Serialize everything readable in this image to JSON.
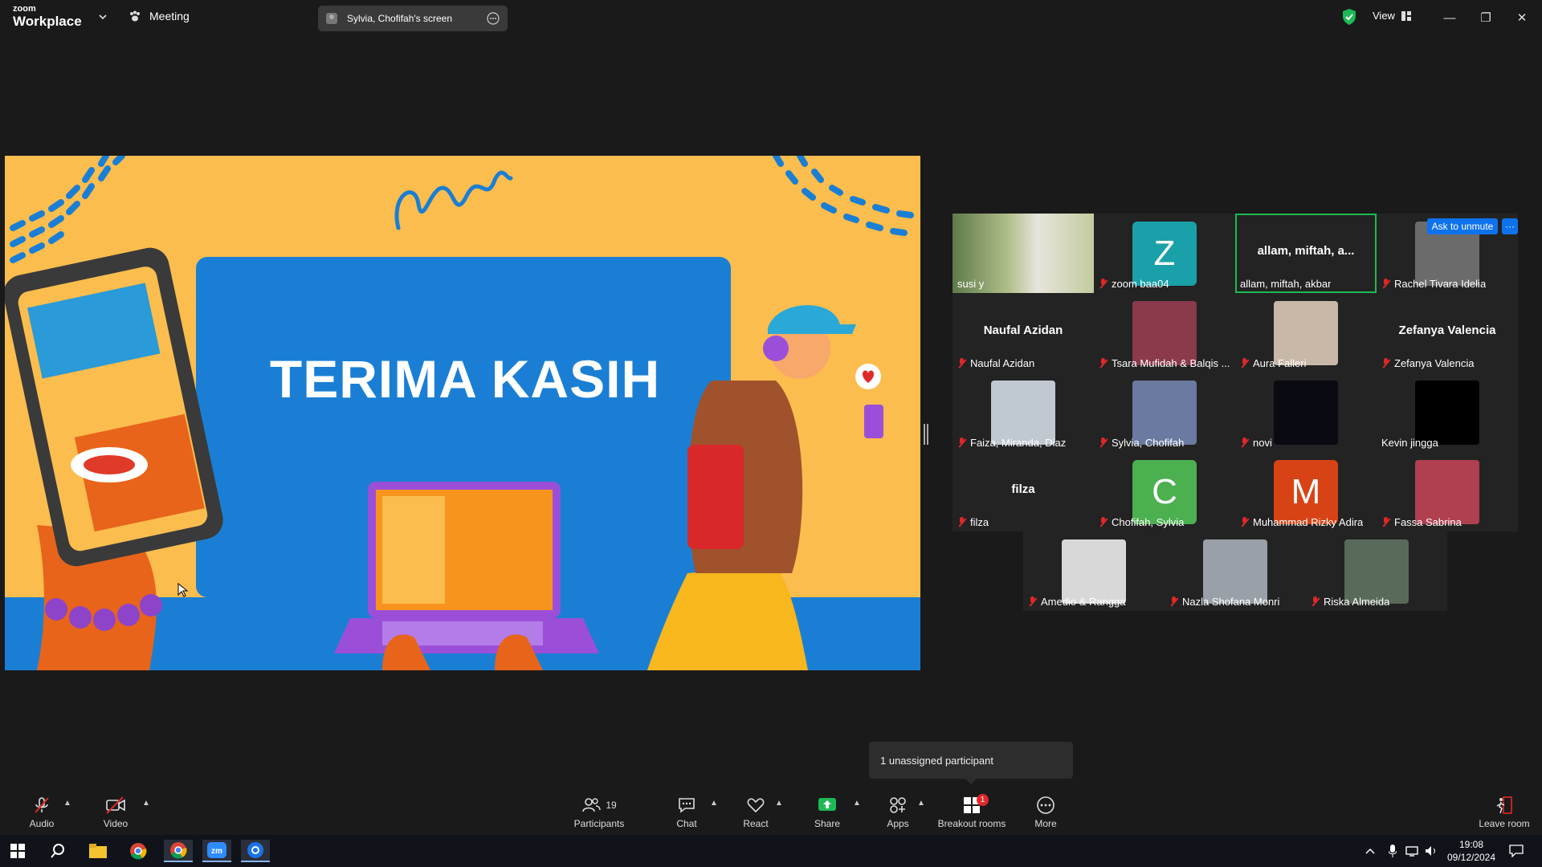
{
  "app": {
    "logo_small": "zoom",
    "logo_big": "Workplace"
  },
  "titlebar": {
    "meeting_label": "Meeting",
    "screen_label": "Sylvia, Chofifah's screen",
    "view_label": "View"
  },
  "share": {
    "title": "TERIMA KASIH"
  },
  "gallery": {
    "ask_to_unmute": "Ask to unmute",
    "more": "···",
    "tiles": [
      {
        "name": "susi y",
        "muted": false,
        "type": "photo",
        "color": "#7c9a6a"
      },
      {
        "name": "zoom baa04",
        "muted": true,
        "type": "avatar",
        "initial": "Z",
        "color": "#1aa0a8"
      },
      {
        "name": "allam, miftah, akbar",
        "muted": false,
        "type": "text",
        "center": "allam, miftah, a...",
        "highlight": true
      },
      {
        "name": "Rachel Tivara Idelia",
        "muted": true,
        "type": "photo",
        "color": "#6b6b6b"
      },
      {
        "name": "Naufal Azidan",
        "muted": true,
        "type": "text",
        "center": "Naufal Azidan"
      },
      {
        "name": "Tsara Mufidah & Balqis ...",
        "muted": true,
        "type": "photo",
        "color": "#8a3a4a"
      },
      {
        "name": "Aura Falleri",
        "muted": true,
        "type": "photo",
        "color": "#c8b8a8"
      },
      {
        "name": "Zefanya Valencia",
        "muted": true,
        "type": "text",
        "center": "Zefanya Valencia"
      },
      {
        "name": "Faiza, Miranda, Diaz",
        "muted": true,
        "type": "photo",
        "color": "#c0c8d0"
      },
      {
        "name": "Sylvia, Chofifah",
        "muted": true,
        "type": "photo",
        "color": "#6a7aa0"
      },
      {
        "name": "novi",
        "muted": true,
        "type": "photo",
        "color": "#0a0a12"
      },
      {
        "name": "Kevin jingga",
        "muted": false,
        "type": "photo",
        "color": "#000000"
      },
      {
        "name": "filza",
        "muted": true,
        "type": "text",
        "center": "filza"
      },
      {
        "name": "Chofifah, Sylvia",
        "muted": true,
        "type": "avatar",
        "initial": "C",
        "color": "#4caf50"
      },
      {
        "name": "Muhammad Rizky Adira",
        "muted": true,
        "type": "avatar",
        "initial": "M",
        "color": "#d84315"
      },
      {
        "name": "Fassa Sabrina",
        "muted": true,
        "type": "photo",
        "color": "#b04050"
      },
      {
        "name": "Amedio & Rangga",
        "muted": true,
        "type": "photo",
        "color": "#d8d8d8"
      },
      {
        "name": "Nazla Shofana Monri",
        "muted": true,
        "type": "photo",
        "color": "#9aa0a8"
      },
      {
        "name": "Riska Almeida",
        "muted": true,
        "type": "photo",
        "color": "#5a6a5a"
      }
    ]
  },
  "tooltip": {
    "text": "1 unassigned participant"
  },
  "toolbar": {
    "audio": "Audio",
    "video": "Video",
    "participants": "Participants",
    "participants_count": "19",
    "chat": "Chat",
    "react": "React",
    "share": "Share",
    "apps": "Apps",
    "breakout": "Breakout rooms",
    "breakout_badge": "1",
    "more": "More",
    "leave": "Leave room"
  },
  "taskbar": {
    "time": "19:08",
    "date": "09/12/2024"
  }
}
